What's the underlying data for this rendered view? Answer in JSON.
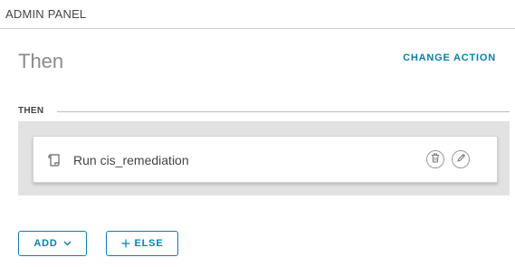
{
  "header": {
    "title": "ADMIN PANEL"
  },
  "section": {
    "title": "Then",
    "change_action_label": "CHANGE ACTION"
  },
  "then_group": {
    "label": "THEN",
    "actions": [
      {
        "icon": "script-icon",
        "label": "Run cis_remediation",
        "controls": [
          "trash-icon",
          "pencil-icon"
        ]
      }
    ]
  },
  "footer": {
    "add_label": "ADD",
    "else_label": "ELSE"
  },
  "colors": {
    "accent": "#0a7fa8",
    "panel_bg": "#e2e2e2",
    "title_gray": "#8a8a8a"
  }
}
